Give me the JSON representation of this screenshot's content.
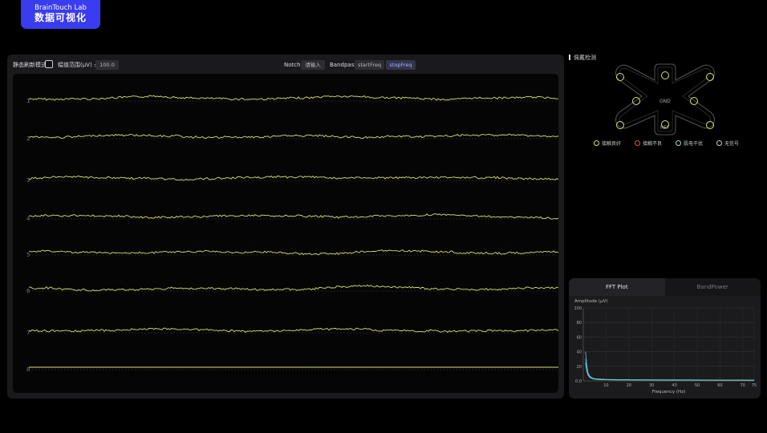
{
  "brand": {
    "line1": "BrainTouch Lab",
    "line2": "数据可视化"
  },
  "toolbar": {
    "static_mode_label": "静态刷新模式",
    "amplitude_label": "幅值范围(μV) ±",
    "amplitude_value": "100.0",
    "notch_label": "Notch",
    "notch_placeholder": "请输入",
    "bandpass_label": "Bandpass",
    "start_freq_placeholder": "startFreq",
    "stop_freq_placeholder": "stopFreq"
  },
  "eeg": {
    "channels": [
      {
        "label": "1",
        "offset_uv": 0
      },
      {
        "label": "2",
        "offset_uv": 0
      },
      {
        "label": "3",
        "offset_uv": 0
      },
      {
        "label": "4",
        "offset_uv": 0
      },
      {
        "label": "5",
        "offset_uv": 0
      },
      {
        "label": "6",
        "offset_uv": 0
      },
      {
        "label": "7",
        "offset_uv": 0
      },
      {
        "label": "8",
        "offset_uv": 0
      }
    ],
    "trace_color": "#d9e36a"
  },
  "electrode": {
    "title": "佩戴检测",
    "gnd_label": "GND",
    "ref_label": "REF",
    "status_good_color": "#d9e36a",
    "legend": [
      {
        "label": "接触良好",
        "color": "#d9e36a"
      },
      {
        "label": "接触不良",
        "color": "#e0505a"
      },
      {
        "label": "肌电干扰",
        "color": "#9fe0d0"
      },
      {
        "label": "无信号",
        "color": "#cccccc"
      }
    ]
  },
  "fft": {
    "tab_fft": "FFT Plot",
    "tab_bandpower": "BandPower"
  },
  "chart_data": {
    "type": "line",
    "title": "",
    "ylabel": "Amplitude (μV)",
    "xlabel": "Frequency (Hz)",
    "xlim": [
      0,
      75
    ],
    "ylim": [
      0,
      100
    ],
    "x_ticks": [
      10,
      20,
      30,
      40,
      50,
      60,
      70,
      75
    ],
    "y_ticks": [
      "0.0",
      "20",
      "40",
      "60",
      "80",
      "100"
    ],
    "grid": true,
    "series": [
      {
        "color": "#5fd0e0",
        "x": [
          1,
          1.5,
          2,
          3,
          4,
          5,
          7,
          10,
          15,
          20,
          30,
          40,
          50,
          60,
          70,
          75
        ],
        "values": [
          40,
          22,
          12,
          6,
          4,
          3,
          2.5,
          2,
          1.8,
          1.6,
          1.5,
          1.4,
          1.3,
          1.2,
          1.2,
          1.1
        ]
      },
      {
        "color": "#3aa8c0",
        "x": [
          1,
          1.5,
          2,
          3,
          4,
          5,
          7,
          10,
          15,
          20,
          30,
          40,
          50,
          60,
          70,
          75
        ],
        "values": [
          30,
          16,
          9,
          5,
          3.5,
          2.6,
          2.1,
          1.7,
          1.5,
          1.4,
          1.3,
          1.2,
          1.1,
          1.1,
          1.0,
          1.0
        ]
      },
      {
        "color": "#7fe8d8",
        "x": [
          1,
          1.5,
          2,
          3,
          4,
          5,
          7,
          10,
          15,
          20,
          30,
          40,
          50,
          60,
          70,
          75
        ],
        "values": [
          25,
          14,
          8,
          4.5,
          3,
          2.3,
          1.9,
          1.5,
          1.3,
          1.2,
          1.1,
          1.0,
          1.0,
          0.9,
          0.9,
          0.9
        ]
      }
    ]
  }
}
